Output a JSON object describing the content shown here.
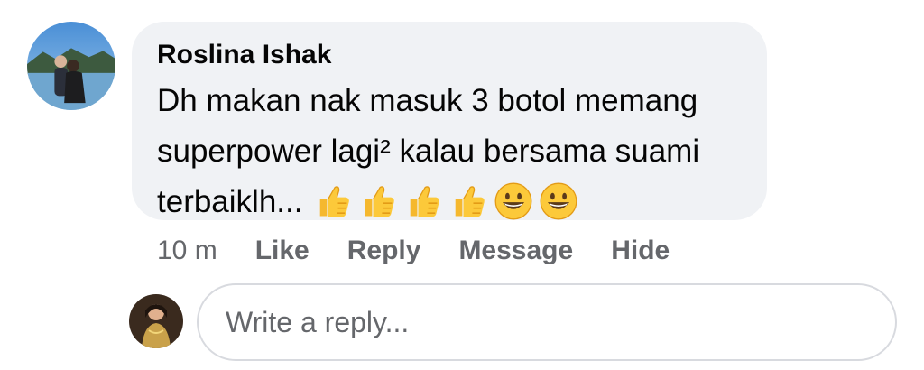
{
  "comment": {
    "author": "Roslina Ishak",
    "text": "Dh makan nak masuk 3 botol memang superpower lagi² kalau bersama suami terbaiklh...",
    "emojis": [
      "thumbs-up-icon",
      "thumbs-up-icon",
      "thumbs-up-icon",
      "thumbs-up-icon",
      "grinning-face-icon",
      "grinning-face-icon"
    ],
    "time": "10 m",
    "actions": {
      "like": "Like",
      "reply": "Reply",
      "message": "Message",
      "hide": "Hide"
    }
  },
  "reply_box": {
    "placeholder": "Write a reply..."
  },
  "colors": {
    "bubble_background": "#f0f2f5",
    "secondary_text": "#65676b",
    "primary_text": "#050505",
    "input_border": "#d8dadf"
  }
}
